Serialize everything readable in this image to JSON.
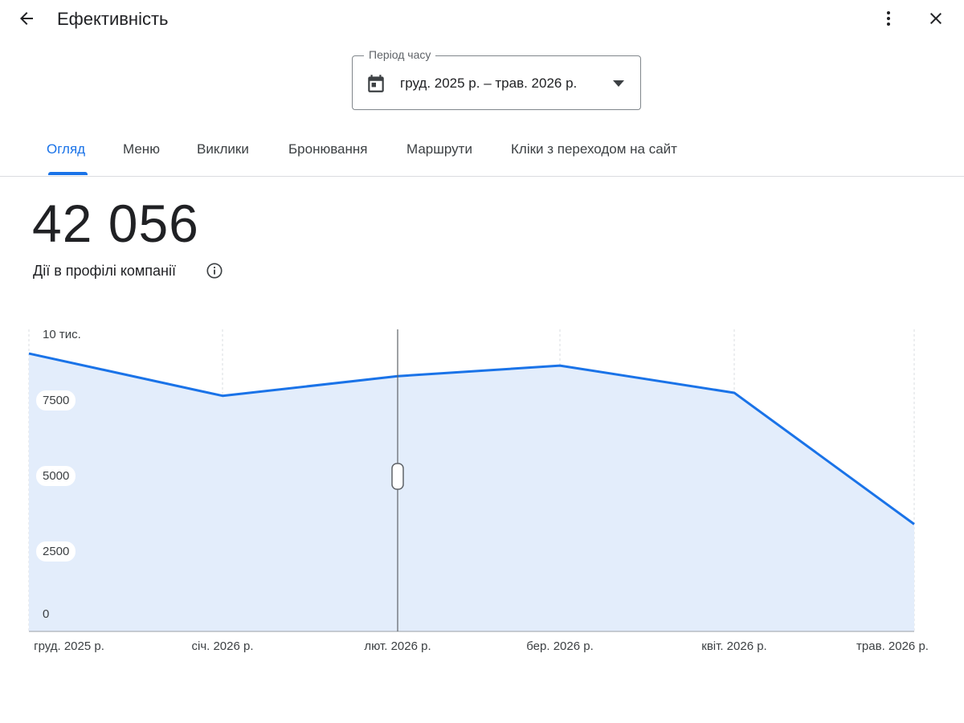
{
  "header": {
    "title": "Ефективність",
    "back_icon": "arrow-back-icon",
    "more_icon": "more-vert-icon",
    "close_icon": "close-icon"
  },
  "period": {
    "label": "Період часу",
    "value": "груд. 2025 р. – трав. 2026 р.",
    "icon": "calendar-icon"
  },
  "tabs": [
    {
      "label": "Огляд",
      "active": true
    },
    {
      "label": "Меню",
      "active": false
    },
    {
      "label": "Виклики",
      "active": false
    },
    {
      "label": "Бронювання",
      "active": false
    },
    {
      "label": "Маршрути",
      "active": false
    },
    {
      "label": "Кліки з переходом на сайт",
      "active": false
    }
  ],
  "summary": {
    "total": "42 056",
    "label": "Дії в профілі компанії"
  },
  "colors": {
    "accent": "#1a73e8",
    "line": "#1a73e8",
    "area": "#e3edfb"
  },
  "chart_data": {
    "type": "area",
    "x": [
      "груд. 2025 р.",
      "січ. 2026 р.",
      "лют. 2026 р.",
      "бер. 2026 р.",
      "квіт. 2026 р.",
      "трав. 2026 р."
    ],
    "series": [
      {
        "values": [
          9200,
          7800,
          8450,
          8800,
          7900,
          3550
        ]
      }
    ],
    "ylim": [
      0,
      10000
    ],
    "yticks": [
      {
        "value": 10000,
        "label": "10 тис."
      },
      {
        "value": 7500,
        "label": "7500"
      },
      {
        "value": 5000,
        "label": "5000"
      },
      {
        "value": 2500,
        "label": "2500"
      },
      {
        "value": 0,
        "label": "0"
      }
    ],
    "grid": "vertical dashed",
    "cursor_index": 2
  }
}
